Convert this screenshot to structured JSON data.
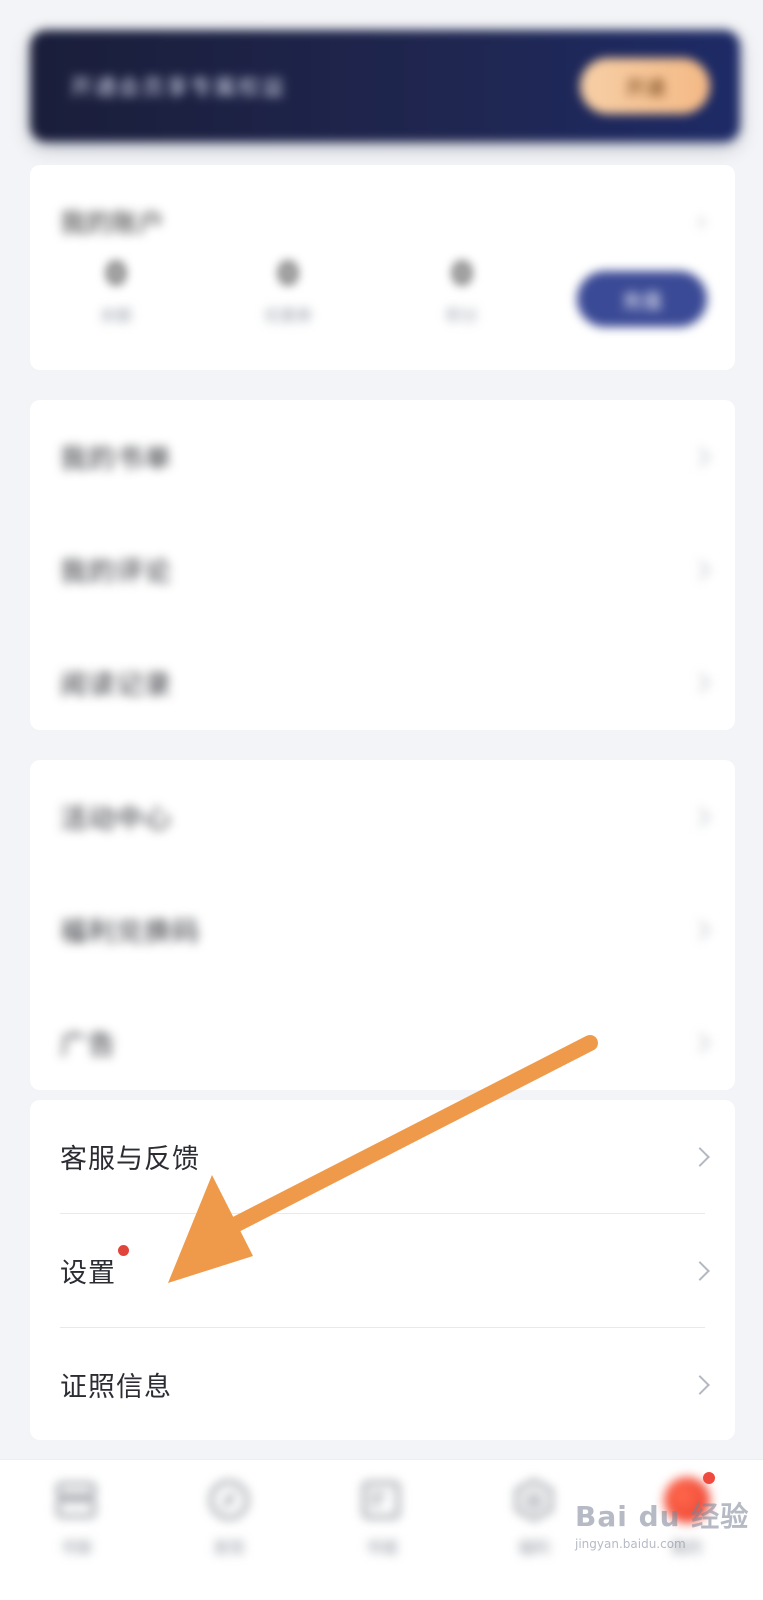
{
  "banner": {
    "text": "开通会员享专属权益",
    "button_label": "开通"
  },
  "account": {
    "title": "我的账户",
    "stats": [
      {
        "value": "0",
        "label": "余额"
      },
      {
        "value": "0",
        "label": "优惠券"
      },
      {
        "value": "0",
        "label": "积分"
      }
    ],
    "button_label": "充值"
  },
  "record_section": {
    "items": [
      {
        "label": "我的书单"
      },
      {
        "label": "我的评论"
      },
      {
        "label": "阅读记录"
      }
    ]
  },
  "tools_section": {
    "items": [
      {
        "label": "活动中心"
      },
      {
        "label": "福利兑换码"
      },
      {
        "label": "广告"
      }
    ]
  },
  "support_section": {
    "items": [
      {
        "label": "客服与反馈"
      },
      {
        "label": "设置"
      },
      {
        "label": "证照信息"
      }
    ]
  },
  "bottom_nav": {
    "items": [
      {
        "label": "书架",
        "icon": "bookshelf-icon"
      },
      {
        "label": "发现",
        "icon": "compass-icon"
      },
      {
        "label": "书城",
        "icon": "book-icon"
      },
      {
        "label": "福利",
        "icon": "gift-icon"
      },
      {
        "label": "我的",
        "icon": "profile-icon"
      }
    ]
  },
  "watermark": {
    "main": "Bai du 经验",
    "sub": "jingyan.baidu.com"
  },
  "colors": {
    "arrow": "#ef9a4a",
    "accent_blue": "#3b4a96",
    "badge_red": "#e0453c"
  }
}
